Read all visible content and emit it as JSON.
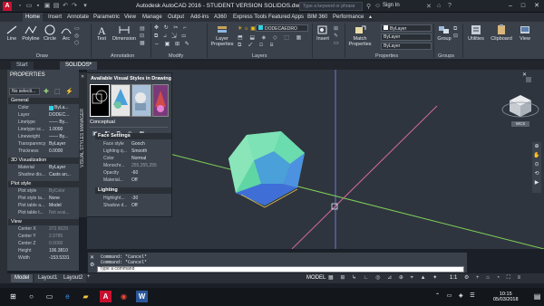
{
  "titlebar": {
    "title": "Autodesk AutoCAD 2016 - STUDENT VERSION     SOLIDOS.dwg",
    "search_placeholder": "Type a keyword or phrase",
    "sign_in": "Sign In",
    "logo_letter": "A"
  },
  "ribbon_tabs": [
    "Home",
    "Insert",
    "Annotate",
    "Parametric",
    "View",
    "Manage",
    "Output",
    "Add-ins",
    "A360",
    "Express Tools",
    "Featured Apps",
    "BIM 360",
    "Performance"
  ],
  "ribbon": {
    "draw": {
      "title": "Draw",
      "line": "Line",
      "polyline": "Polyline",
      "circle": "Circle",
      "arc": "Arc"
    },
    "annotation": {
      "title": "Annotation",
      "text": "Text",
      "dimension": "Dimension"
    },
    "modify": {
      "title": "Modify"
    },
    "layers": {
      "title": "Layers",
      "layer_properties": "Layer Properties",
      "layer_combo": "DODECAEDRO"
    },
    "block": {
      "insert": "Insert"
    },
    "properties": {
      "title": "Properties",
      "match": "Match Properties",
      "bylayer1": "ByLayer",
      "bylayer2": "ByLayer",
      "bylayer3": "ByLayer"
    },
    "groups": {
      "title": "Groups",
      "group": "Group"
    },
    "utilities": "Utilities",
    "clipboard": "Clipboard",
    "view": "View"
  },
  "doc_tabs": [
    "Start",
    "SOLIDOS*"
  ],
  "properties_panel": {
    "title": "PROPERTIES",
    "selection": "No selecti...",
    "sections": {
      "general": {
        "title": "General",
        "rows": [
          {
            "k": "Color",
            "v": "ByLa..."
          },
          {
            "k": "Layer",
            "v": "DODEC..."
          },
          {
            "k": "Linetype",
            "v": "—— By..."
          },
          {
            "k": "Linetype sc...",
            "v": "1.0000"
          },
          {
            "k": "Lineweight",
            "v": "—— By..."
          },
          {
            "k": "Transparency",
            "v": "ByLayer"
          },
          {
            "k": "Thickness",
            "v": "0.0000"
          }
        ]
      },
      "viz": {
        "title": "3D Visualization",
        "rows": [
          {
            "k": "Material",
            "v": "ByLayer"
          },
          {
            "k": "Shadow dis...",
            "v": "Casts an..."
          }
        ]
      },
      "plot": {
        "title": "Plot style",
        "rows": [
          {
            "k": "Plot style",
            "v": "ByColor"
          },
          {
            "k": "Plot style ta...",
            "v": "None"
          },
          {
            "k": "Plot table a...",
            "v": "Model"
          },
          {
            "k": "Plot table t...",
            "v": "Not avai..."
          }
        ]
      },
      "view": {
        "title": "View",
        "rows": [
          {
            "k": "Center X",
            "v": "372.9029"
          },
          {
            "k": "Center Y",
            "v": "2.9785"
          },
          {
            "k": "Center Z",
            "v": "0.0000"
          },
          {
            "k": "Height",
            "v": "106.3810"
          },
          {
            "k": "Width",
            "v": "-153.5331"
          }
        ]
      }
    }
  },
  "visual_styles": {
    "header": "Available Visual Styles in Drawing",
    "current": "Conceptual",
    "strip_label": "VISUAL STYLES MANAGER",
    "face_settings": {
      "title": "Face Settings",
      "rows": [
        {
          "k": "Face style",
          "v": "Gooch"
        },
        {
          "k": "Lighting q...",
          "v": "Smooth"
        },
        {
          "k": "Color",
          "v": "Normal"
        },
        {
          "k": "Monochr...",
          "v": "255,255,255"
        },
        {
          "k": "Opacity",
          "v": "-60"
        },
        {
          "k": "Material...",
          "v": "Off"
        }
      ]
    },
    "lighting": {
      "title": "Lighting",
      "rows": [
        {
          "k": "Highlight...",
          "v": "-30"
        },
        {
          "k": "Shadow d...",
          "v": "Off"
        }
      ]
    }
  },
  "viewcube": {
    "label": "WCS"
  },
  "command_line": {
    "lines": [
      "Command: *Cancel*",
      "Command: *Cancel*"
    ],
    "prompt": "Type a command"
  },
  "layout_tabs": [
    "Model",
    "Layout1",
    "Layout2"
  ],
  "status_bar": {
    "model": "MODEL",
    "scale": "1:1"
  },
  "clock": {
    "time": "10:15",
    "date": "05/03/2018"
  },
  "colors": {
    "accent": "#1c7bd5",
    "solid_face": "#6fe0a0",
    "solid_side": "#3f6fd6",
    "logo": "#c8102e"
  }
}
